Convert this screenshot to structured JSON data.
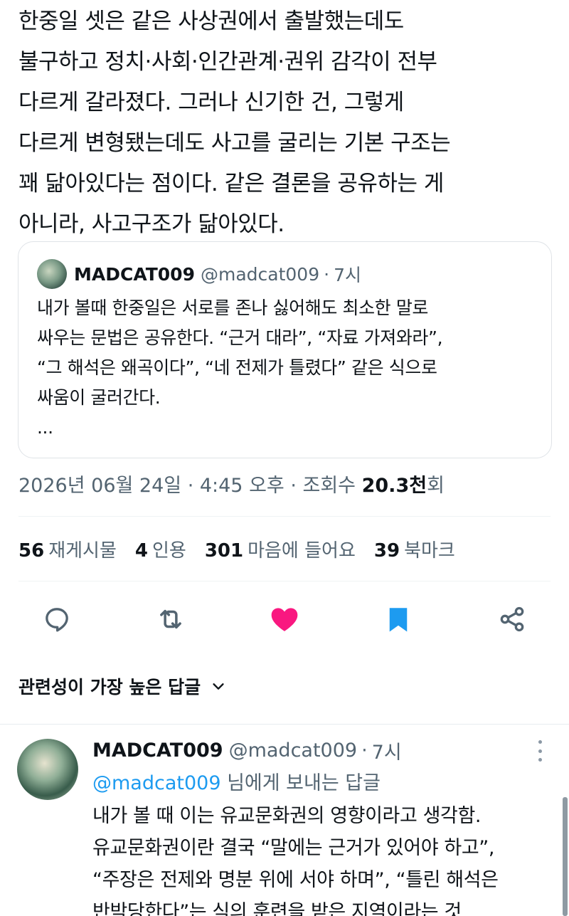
{
  "post": {
    "lines": [
      "한중일 셋은 같은 사상권에서 출발했는데도",
      "불구하고 정치·사회·인간관계·권위 감각이 전부",
      "다르게 갈라졌다. 그러나 신기한 건, 그렇게",
      "다르게 변형됐는데도 사고를 굴리는 기본 구조는",
      "꽤 닮아있다는 점이다. 같은 결론을 공유하는 게",
      "아니라, 사고구조가 닮아있다."
    ]
  },
  "quote": {
    "name": "MADCAT009",
    "handle": "@madcat009",
    "separator": "·",
    "time": "7시",
    "lines": [
      "내가 볼때 한중일은 서로를 존나 싫어해도 최소한 말로",
      "싸우는 문법은 공유한다.  “근거 대라”, “자료 가져와라”,",
      "“그 해석은 왜곡이다”, “네 전제가 틀렸다” 같은 식으로",
      "싸움이 굴러간다.",
      "..."
    ]
  },
  "meta": {
    "date": "2026년 06월 24일 · 4:45 오후 · 조회수 ",
    "views": "20.3천",
    "views_suffix": "회"
  },
  "stats": [
    {
      "count": "56",
      "label": "재게시물"
    },
    {
      "count": "4",
      "label": "인용"
    },
    {
      "count": "301",
      "label": "마음에 들어요"
    },
    {
      "count": "39",
      "label": "북마크"
    }
  ],
  "actions": {
    "reply_icon": "reply-icon",
    "repost_icon": "repost-icon",
    "like_icon": "heart-icon",
    "bookmark_icon": "bookmark-icon",
    "share_icon": "share-icon",
    "like_color": "#f91880",
    "bookmark_color": "#1d9bf0"
  },
  "sort": {
    "label": "관련성이 가장 높은 답글"
  },
  "reply": {
    "name": "MADCAT009",
    "handle": "@madcat009",
    "separator": "·",
    "time": "7시",
    "reply_to_mention": "@madcat009",
    "reply_to_suffix": " 님에게 보내는 답글",
    "lines": [
      "내가 볼 때 이는 유교문화권의 영향이라고 생각함.",
      "유교문화권이란 결국 “말에는 근거가 있어야 하고”,",
      "“주장은 전제와 명분 위에 서야 하며”, “틀린 해석은",
      "반박당한다”는 식의 훈련을 받은 지역이라는 것"
    ]
  }
}
